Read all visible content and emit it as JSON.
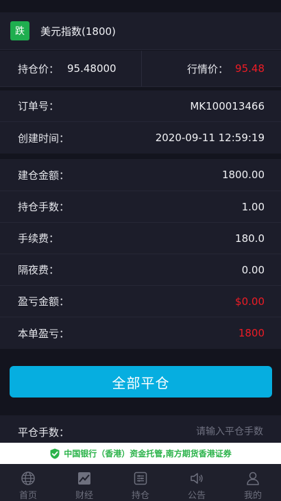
{
  "product": {
    "badge": "跌",
    "name": "美元指数(1800)"
  },
  "prices": {
    "hold_label": "持仓价：",
    "hold_value": "95.48000",
    "market_label": "行情价：",
    "market_value": "95.48"
  },
  "order": {
    "order_no_label": "订单号：",
    "order_no": "MK100013466",
    "created_label": "创建时间：",
    "created": "2020-09-11 12:59:19"
  },
  "details": {
    "amount_label": "建仓金额：",
    "amount": "1800.00",
    "lots_label": "持仓手数：",
    "lots": "1.00",
    "fee_label": "手续费：",
    "fee": "180.0",
    "overnight_label": "隔夜费：",
    "overnight": "0.00",
    "pnl_label": "盈亏金额：",
    "pnl": "$0.00",
    "single_pnl_label": "本单盈亏：",
    "single_pnl": "1800"
  },
  "close_all_label": "全部平仓",
  "close_input": {
    "label": "平仓手数：",
    "placeholder": "请输入平仓手数"
  },
  "banner_text": "中国银行（香港）资金托管,南方期货香港证券",
  "tabs": [
    {
      "label": "首页",
      "icon": "globe-icon"
    },
    {
      "label": "财经",
      "icon": "chart-icon"
    },
    {
      "label": "持仓",
      "icon": "position-icon"
    },
    {
      "label": "公告",
      "icon": "speaker-icon"
    },
    {
      "label": "我的",
      "icon": "user-icon"
    }
  ],
  "colors": {
    "accent": "#06aee0",
    "down_badge": "#1fae4f",
    "loss_red": "#ee1c25",
    "banner_green": "#2bb34a"
  }
}
